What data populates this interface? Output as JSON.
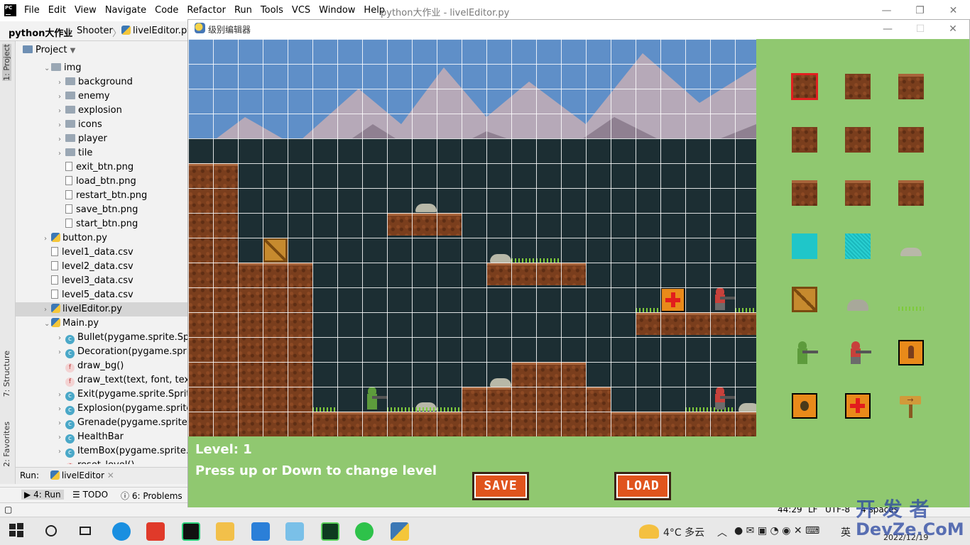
{
  "ide": {
    "title": "python大作业 - livelEditor.py",
    "menu": [
      "File",
      "Edit",
      "View",
      "Navigate",
      "Code",
      "Refactor",
      "Run",
      "Tools",
      "VCS",
      "Window",
      "Help"
    ],
    "breadcrumbs": [
      "python大作业",
      "Shooter",
      "livelEditor.py"
    ],
    "left_tabs": [
      "1: Project",
      "7: Structure",
      "2: Favorites"
    ],
    "project_header": "Project",
    "tree": [
      {
        "label": "img",
        "kind": "folder",
        "indent": 0,
        "open": true
      },
      {
        "label": "background",
        "kind": "folder",
        "indent": 1
      },
      {
        "label": "enemy",
        "kind": "folder",
        "indent": 1
      },
      {
        "label": "explosion",
        "kind": "folder",
        "indent": 1
      },
      {
        "label": "icons",
        "kind": "folder",
        "indent": 1
      },
      {
        "label": "player",
        "kind": "folder",
        "indent": 1
      },
      {
        "label": "tile",
        "kind": "folder",
        "indent": 1
      },
      {
        "label": "exit_btn.png",
        "kind": "file",
        "indent": 1
      },
      {
        "label": "load_btn.png",
        "kind": "file",
        "indent": 1
      },
      {
        "label": "restart_btn.png",
        "kind": "file",
        "indent": 1
      },
      {
        "label": "save_btn.png",
        "kind": "file",
        "indent": 1
      },
      {
        "label": "start_btn.png",
        "kind": "file",
        "indent": 1
      },
      {
        "label": "button.py",
        "kind": "py",
        "indent": 0
      },
      {
        "label": "level1_data.csv",
        "kind": "file",
        "indent": 0
      },
      {
        "label": "level2_data.csv",
        "kind": "file",
        "indent": 0
      },
      {
        "label": "level3_data.csv",
        "kind": "file",
        "indent": 0
      },
      {
        "label": "level5_data.csv",
        "kind": "file",
        "indent": 0
      },
      {
        "label": "livelEditor.py",
        "kind": "py",
        "indent": 0,
        "selected": true
      },
      {
        "label": "Main.py",
        "kind": "py",
        "indent": 0,
        "open": true
      },
      {
        "label": "Bullet(pygame.sprite.Spr",
        "kind": "class",
        "indent": 1
      },
      {
        "label": "Decoration(pygame.sprit",
        "kind": "class",
        "indent": 1
      },
      {
        "label": "draw_bg()",
        "kind": "func",
        "indent": 1
      },
      {
        "label": "draw_text(text, font, text_",
        "kind": "func",
        "indent": 1
      },
      {
        "label": "Exit(pygame.sprite.Sprite",
        "kind": "class",
        "indent": 1
      },
      {
        "label": "Explosion(pygame.sprite",
        "kind": "class",
        "indent": 1
      },
      {
        "label": "Grenade(pygame.sprite.",
        "kind": "class",
        "indent": 1
      },
      {
        "label": "HealthBar",
        "kind": "class",
        "indent": 1
      },
      {
        "label": "ItemBox(pygame.sprite.S",
        "kind": "class",
        "indent": 1
      },
      {
        "label": "reset_level()",
        "kind": "func",
        "indent": 1
      }
    ],
    "run_label": "Run:",
    "run_tab": "livelEditor",
    "bottom_tabs": [
      "4: Run",
      "TODO",
      "6: Problems"
    ],
    "status": [
      "44:29",
      "LF",
      "UTF-8",
      "4 spaces"
    ]
  },
  "editor_window": {
    "title": "级别编辑器",
    "level_label": "Level: 1",
    "help_text": "Press up or Down to change level",
    "save_label": "SAVE",
    "load_label": "LOAD"
  },
  "taskbar": {
    "weather": "4°C 多云",
    "ime": "英",
    "clock": "2022/12/19"
  },
  "watermark": [
    "开 发 者",
    "DevZe.CoM"
  ]
}
